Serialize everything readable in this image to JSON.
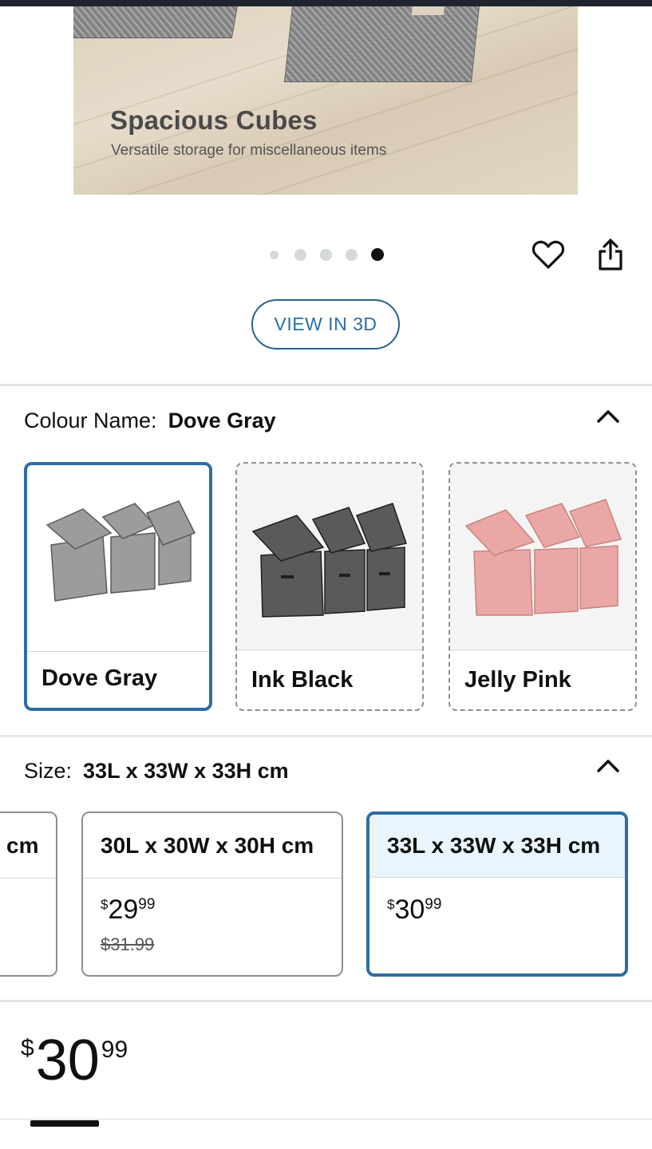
{
  "hero": {
    "title": "Spacious Cubes",
    "subtitle": "Versatile storage for miscellaneous items"
  },
  "carousel": {
    "total_dots": 5,
    "active_index": 4
  },
  "actions": {
    "favorite_icon": "heart-icon",
    "share_icon": "share-icon"
  },
  "view3d": {
    "label": "VIEW IN 3D"
  },
  "colour": {
    "label": "Colour Name:",
    "selected": "Dove Gray",
    "options": [
      {
        "name": "Dove Gray",
        "color": "#9a9a9a",
        "selected": true
      },
      {
        "name": "Ink Black",
        "color": "#4a4a4a",
        "selected": false
      },
      {
        "name": "Jelly Pink",
        "color": "#e8a9a6",
        "selected": false
      }
    ]
  },
  "size": {
    "label": "Size:",
    "selected": "33L x 33W x 33H cm",
    "options": [
      {
        "label": "cm",
        "price_whole": "",
        "price_cents": "",
        "list_price": ""
      },
      {
        "label": "30L x 30W x 30H cm",
        "currency": "$",
        "price_whole": "29",
        "price_cents": "99",
        "list_price": "$31.99"
      },
      {
        "label": "33L x 33W x 33H cm",
        "currency": "$",
        "price_whole": "30",
        "price_cents": "99",
        "list_price": ""
      }
    ]
  },
  "price": {
    "currency": "$",
    "whole": "30",
    "cents": "99"
  },
  "colors": {
    "accent_blue": "#2e6da4",
    "link_blue": "#2b6ea8",
    "divider": "#e3e6e6",
    "text": "#0f1111"
  }
}
